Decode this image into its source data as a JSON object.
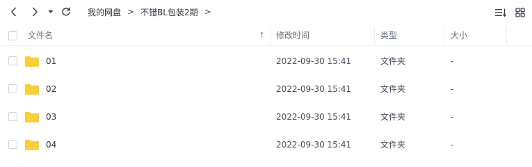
{
  "breadcrumb": {
    "items": [
      "我的网盘",
      "不错BL包装2期"
    ],
    "separator": ">"
  },
  "table": {
    "headers": {
      "name": "文件名",
      "modified": "修改时间",
      "type": "类型",
      "size": "大小"
    },
    "sort_indicator": "↑",
    "rows": [
      {
        "name": "01",
        "modified": "2022-09-30 15:41",
        "type": "文件夹",
        "size": "-"
      },
      {
        "name": "02",
        "modified": "2022-09-30 15:41",
        "type": "文件夹",
        "size": "-"
      },
      {
        "name": "03",
        "modified": "2022-09-30 15:41",
        "type": "文件夹",
        "size": "-"
      },
      {
        "name": "04",
        "modified": "2022-09-30 15:41",
        "type": "文件夹",
        "size": "-"
      }
    ]
  },
  "icons": {
    "back": "chevron-left-icon",
    "forward": "chevron-right-icon",
    "history": "caret-down-icon",
    "refresh": "refresh-icon",
    "sort": "sort-list-icon",
    "view": "grid-view-icon",
    "folder": "folder-icon"
  },
  "colors": {
    "folder": "#f9cf40",
    "sort_arrow": "#1fa3e8",
    "text": "#2f3542",
    "muted": "#6b7280"
  }
}
